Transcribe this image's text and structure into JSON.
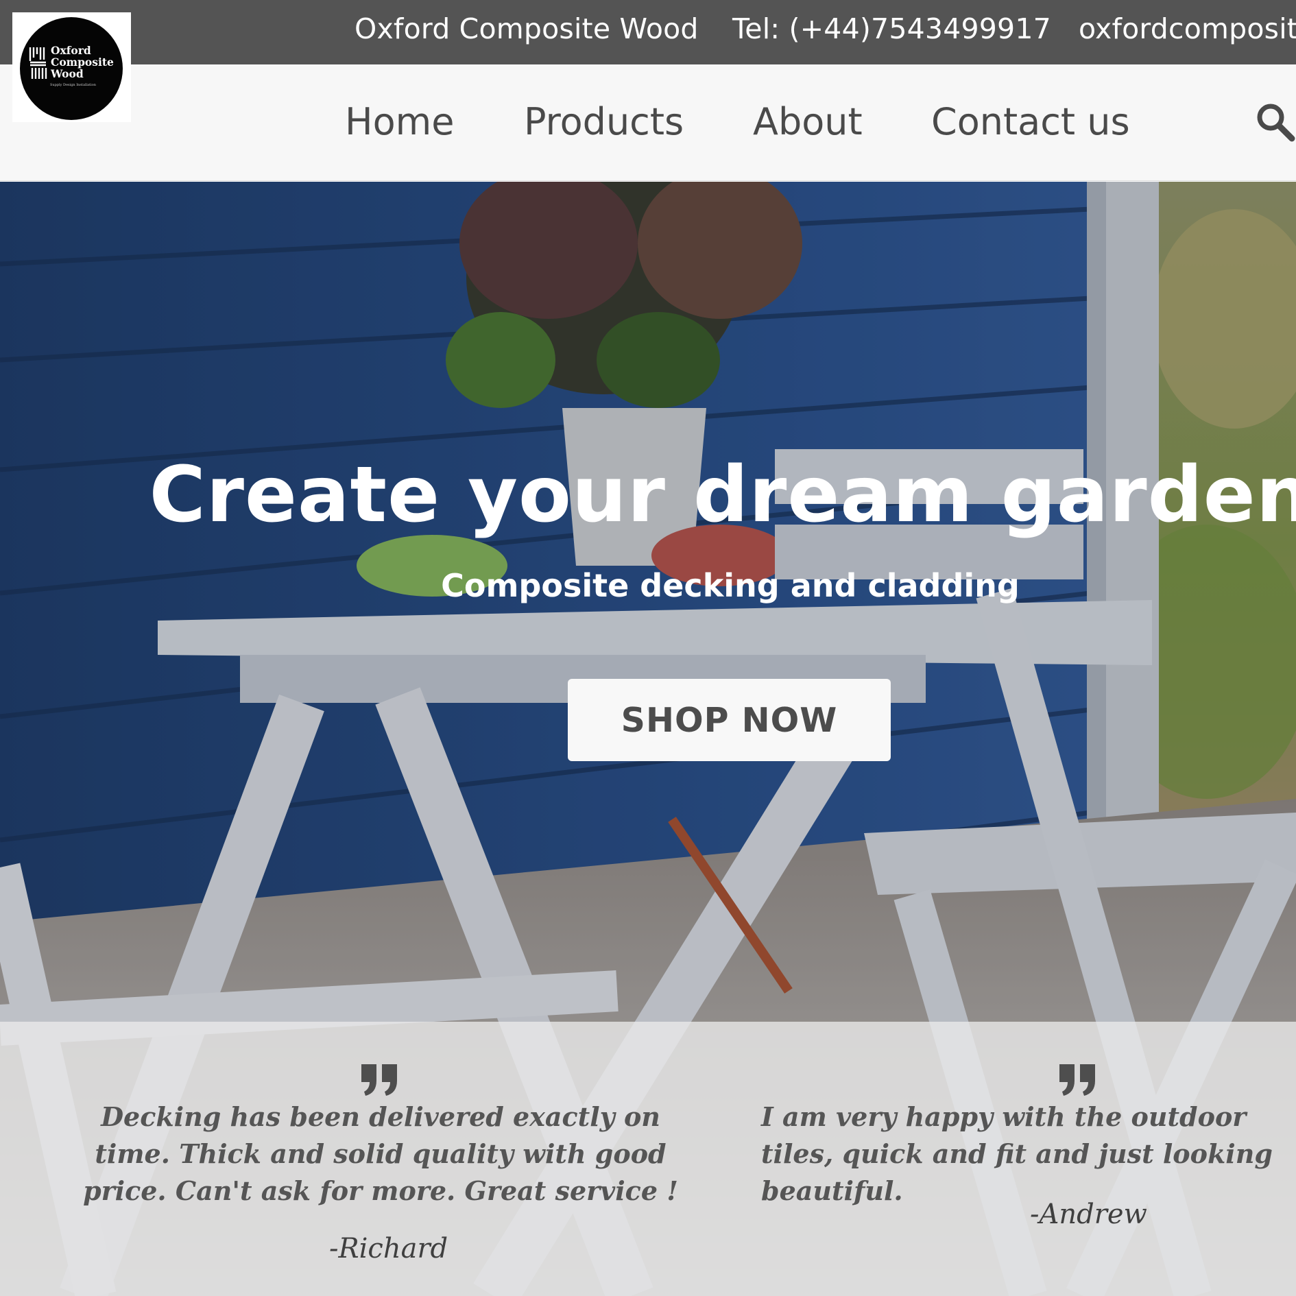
{
  "topbar": {
    "company": "Oxford Composite Wood",
    "phone": "Tel: (+44)7543499917",
    "email": "oxfordcomposite"
  },
  "logo": {
    "line1": "Oxford",
    "line2": "Composite",
    "line3": "Wood",
    "tagline": "Supply Design Installation"
  },
  "nav": {
    "items": [
      {
        "label": "Home"
      },
      {
        "label": "Products"
      },
      {
        "label": "About"
      },
      {
        "label": "Contact us"
      }
    ],
    "search_icon": "search-icon"
  },
  "hero": {
    "title": "Create your dream garden",
    "subtitle": "Composite decking and cladding",
    "cta_label": "SHOP NOW"
  },
  "testimonials": [
    {
      "text": "Decking has been delivered exactly on time. Thick and solid quality with good price. Can't ask for more. Great service !",
      "author": "-Richard"
    },
    {
      "text": "I am very happy with the outdoor tiles, quick and fit and just looking beautiful.",
      "author": "-Andrew"
    }
  ],
  "colors": {
    "topbar_bg": "#545454",
    "navbar_bg": "#f7f7f7",
    "nav_text": "#4a4a4a",
    "hero_blue": "#2b4f86",
    "button_bg": "#f8f8f8",
    "button_text": "#4c4c4c"
  }
}
